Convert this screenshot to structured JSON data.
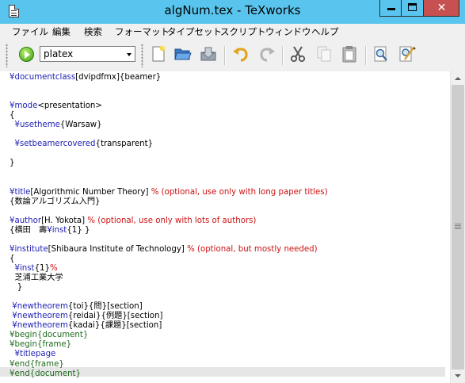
{
  "window": {
    "title": "algNum.tex - TeXworks",
    "close_glyph": "✕"
  },
  "menu": [
    "ファイル",
    "編集",
    "検索",
    "フォーマット",
    "タイプセット",
    "スクリプト",
    "ウィンドウ",
    "ヘルプ"
  ],
  "toolbar": {
    "engine": "platex",
    "icons": [
      "new-file-icon",
      "open-folder-icon",
      "save-icon",
      "undo-icon",
      "redo-icon",
      "cut-icon",
      "copy-icon",
      "paste-icon",
      "find-icon",
      "replace-icon"
    ]
  },
  "colors": {
    "titlebar": "#59c5ee",
    "command": "#1f1fb3",
    "environment": "#1f6b1f",
    "comment": "#cc1111"
  },
  "editor": {
    "lines": [
      [
        [
          "cmd",
          "¥documentclass"
        ],
        [
          "txt",
          "[dvipdfmx]{beamer}"
        ]
      ],
      [],
      [],
      [
        [
          "cmd",
          "¥mode"
        ],
        [
          "txt",
          "<presentation>"
        ]
      ],
      [
        [
          "txt",
          "{"
        ]
      ],
      [
        [
          "txt",
          "  "
        ],
        [
          "cmd",
          "¥usetheme"
        ],
        [
          "txt",
          "{Warsaw}"
        ]
      ],
      [],
      [
        [
          "txt",
          "  "
        ],
        [
          "cmd",
          "¥setbeamercovered"
        ],
        [
          "txt",
          "{transparent}"
        ]
      ],
      [],
      [
        [
          "txt",
          "}"
        ]
      ],
      [],
      [],
      [
        [
          "cmd",
          "¥title"
        ],
        [
          "txt",
          "[Algorithmic Number Theory] "
        ],
        [
          "com",
          "% (optional, use only with long paper titles)"
        ]
      ],
      [
        [
          "txt",
          "{数論アルゴリズム入門}"
        ]
      ],
      [],
      [
        [
          "cmd",
          "¥author"
        ],
        [
          "txt",
          "[H. Yokota] "
        ],
        [
          "com",
          "% (optional, use only with lots of authors)"
        ]
      ],
      [
        [
          "txt",
          "{横田　壽"
        ],
        [
          "cmd",
          "¥inst"
        ],
        [
          "txt",
          "{1} }"
        ]
      ],
      [],
      [
        [
          "cmd",
          "¥institute"
        ],
        [
          "txt",
          "[Shibaura Institute of Technology] "
        ],
        [
          "com",
          "% (optional, but mostly needed)"
        ]
      ],
      [
        [
          "txt",
          "{"
        ]
      ],
      [
        [
          "txt",
          "  "
        ],
        [
          "cmd",
          "¥inst"
        ],
        [
          "txt",
          "{1}"
        ],
        [
          "com",
          "%"
        ]
      ],
      [
        [
          "txt",
          "  芝浦工業大学"
        ]
      ],
      [
        [
          "txt",
          "   }"
        ]
      ],
      [],
      [
        [
          "txt",
          " "
        ],
        [
          "cmd",
          "¥newtheorem"
        ],
        [
          "txt",
          "{toi}{問}[section]"
        ]
      ],
      [
        [
          "txt",
          " "
        ],
        [
          "cmd",
          "¥newtheorem"
        ],
        [
          "txt",
          "{reidai}{例題}[section]"
        ]
      ],
      [
        [
          "txt",
          " "
        ],
        [
          "cmd",
          "¥newtheorem"
        ],
        [
          "txt",
          "{kadai}{課題}[section]"
        ]
      ],
      [
        [
          "env",
          "¥begin{document}"
        ]
      ],
      [
        [
          "env",
          "¥begin{frame}"
        ]
      ],
      [
        [
          "txt",
          "  "
        ],
        [
          "cmd",
          "¥titlepage"
        ]
      ],
      [
        [
          "env",
          "¥end{frame}"
        ]
      ],
      [
        [
          "env",
          "¥end{document}"
        ]
      ]
    ]
  }
}
